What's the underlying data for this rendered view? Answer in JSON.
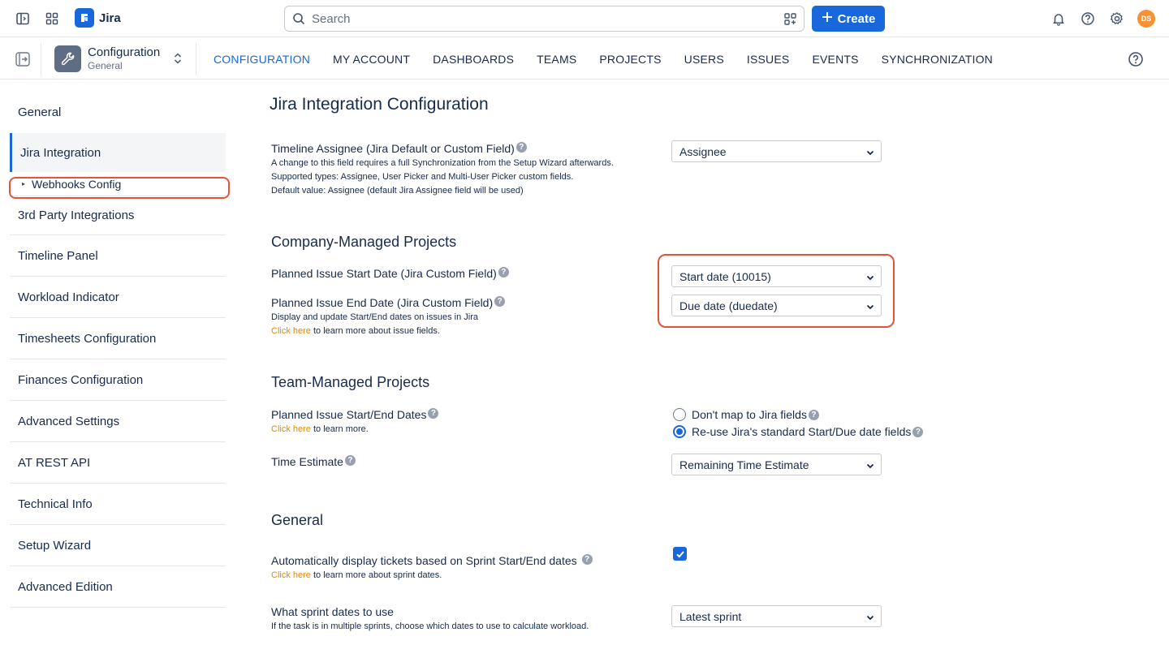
{
  "topbar": {
    "app_name": "Jira",
    "search_placeholder": "Search",
    "create_label": "Create",
    "avatar_initials": "DS"
  },
  "subbar": {
    "space_title": "Configuration",
    "space_subtitle": "General",
    "nav": [
      {
        "label": "CONFIGURATION",
        "active": true
      },
      {
        "label": "MY ACCOUNT"
      },
      {
        "label": "DASHBOARDS"
      },
      {
        "label": "TEAMS"
      },
      {
        "label": "PROJECTS"
      },
      {
        "label": "USERS"
      },
      {
        "label": "ISSUES"
      },
      {
        "label": "EVENTS"
      },
      {
        "label": "SYNCHRONIZATION"
      }
    ]
  },
  "sidebar": {
    "items": [
      {
        "label": "General"
      },
      {
        "label": "Jira Integration"
      },
      {
        "label": "Webhooks Config"
      },
      {
        "label": "3rd Party Integrations"
      },
      {
        "label": "Timeline Panel"
      },
      {
        "label": "Workload Indicator"
      },
      {
        "label": "Timesheets Configuration"
      },
      {
        "label": "Finances Configuration"
      },
      {
        "label": "Advanced Settings"
      },
      {
        "label": "AT REST API"
      },
      {
        "label": "Technical Info"
      },
      {
        "label": "Setup Wizard"
      },
      {
        "label": "Advanced Edition"
      }
    ]
  },
  "main": {
    "title": "Jira Integration Configuration",
    "timeline_assignee": {
      "label": "Timeline Assignee (Jira Default or Custom Field)",
      "hint1": "A change to this field requires a full Synchronization from the Setup Wizard afterwards.",
      "hint2": "Supported types: Assignee, User Picker and Multi-User Picker custom fields.",
      "hint3": "Default value: Assignee (default Jira Assignee field will be used)",
      "value": "Assignee"
    },
    "company": {
      "heading": "Company-Managed Projects",
      "start_label": "Planned Issue Start Date (Jira Custom Field)",
      "end_label": "Planned Issue End Date (Jira Custom Field)",
      "hint": "Display and update Start/End dates on issues in Jira",
      "link": "Click here",
      "link_rest": " to learn more about issue fields.",
      "start_value": "Start date (10015)",
      "end_value": "Due date (duedate)"
    },
    "team": {
      "heading": "Team-Managed Projects",
      "dates_label": "Planned Issue Start/End Dates",
      "link": "Click here",
      "link_rest": " to learn more.",
      "radio1": "Don't map to Jira fields",
      "radio2": "Re-use Jira's standard Start/Due date fields",
      "time_label": "Time Estimate",
      "time_value": "Remaining Time Estimate"
    },
    "general": {
      "heading": "General",
      "auto_label": "Automatically display tickets based on Sprint Start/End dates",
      "link": "Click here",
      "link_rest": " to learn more about sprint dates.",
      "sprint_label": "What sprint dates to use",
      "sprint_hint": "If the task is in multiple sprints, choose which dates to use to calculate workload.",
      "sprint_value": "Latest sprint"
    }
  }
}
